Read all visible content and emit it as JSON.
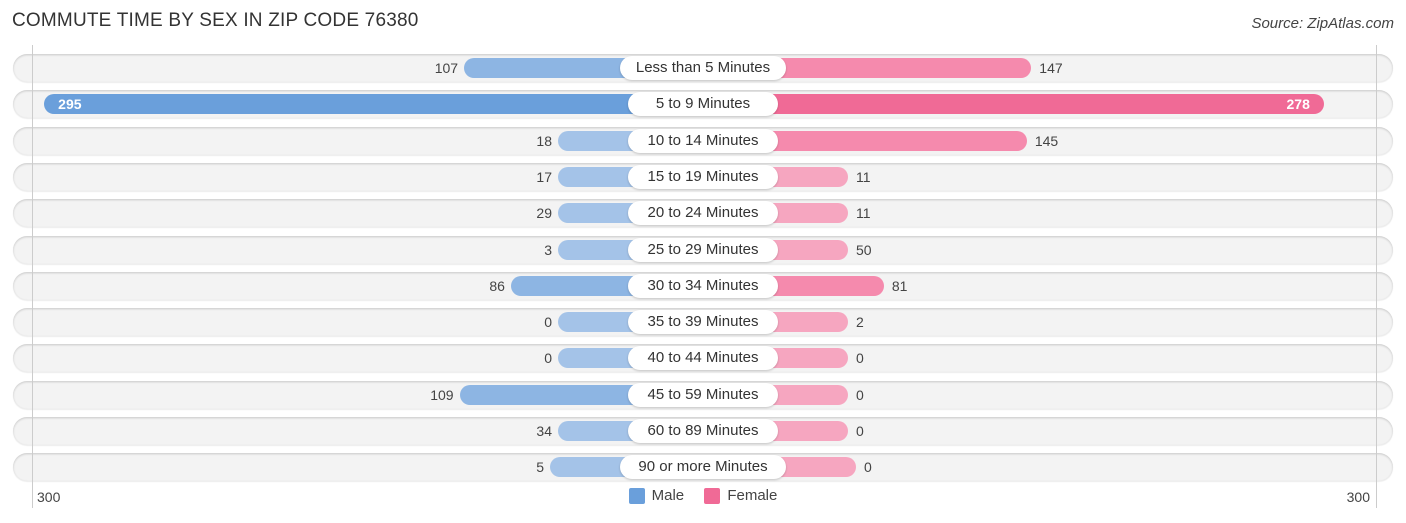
{
  "header": {
    "title": "COMMUTE TIME BY SEX IN ZIP CODE 76380",
    "source": "Source: ZipAtlas.com"
  },
  "colors": {
    "male": "#6a9fdb",
    "male_light": "#a4c3e8",
    "female": "#f06a96",
    "female_light": "#f6a6c0",
    "row_background": "#f3f3f3"
  },
  "chart_data": {
    "type": "bar",
    "orientation": "horizontal-diverging",
    "title": "COMMUTE TIME BY SEX IN ZIP CODE 76380",
    "categories": [
      "Less than 5 Minutes",
      "5 to 9 Minutes",
      "10 to 14 Minutes",
      "15 to 19 Minutes",
      "20 to 24 Minutes",
      "25 to 29 Minutes",
      "30 to 34 Minutes",
      "35 to 39 Minutes",
      "40 to 44 Minutes",
      "45 to 59 Minutes",
      "60 to 89 Minutes",
      "90 or more Minutes"
    ],
    "series": [
      {
        "name": "Male",
        "values": [
          107,
          295,
          18,
          17,
          29,
          3,
          86,
          0,
          0,
          109,
          34,
          5
        ]
      },
      {
        "name": "Female",
        "values": [
          147,
          278,
          145,
          11,
          11,
          50,
          81,
          2,
          0,
          0,
          0,
          0
        ]
      }
    ],
    "axis": {
      "left_label": "300",
      "right_label": "300",
      "max": 300
    },
    "legend": {
      "position": "bottom-center",
      "entries": [
        "Male",
        "Female"
      ]
    },
    "grid": false
  }
}
